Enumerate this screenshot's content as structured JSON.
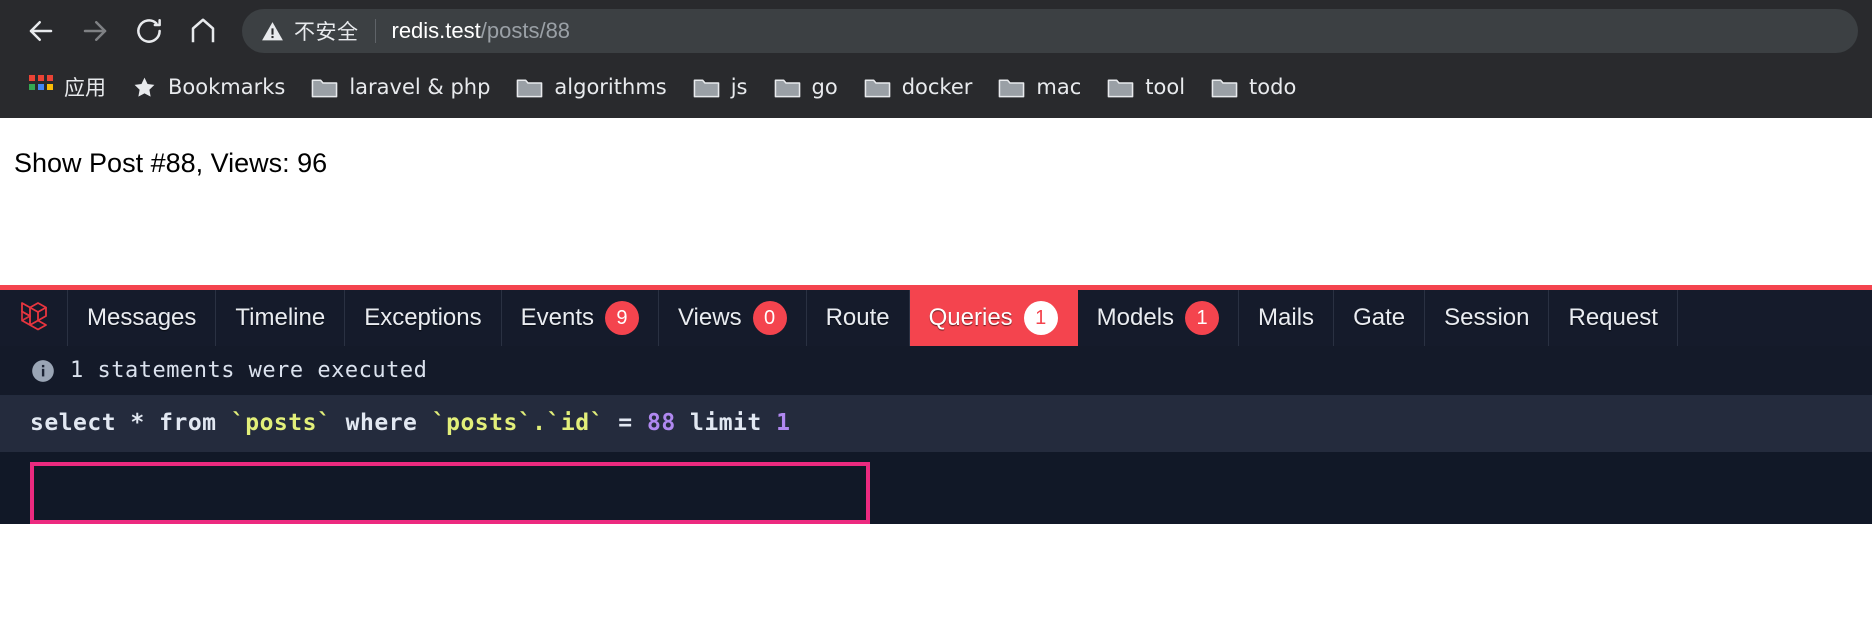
{
  "browser": {
    "nav": [
      {
        "name": "back-button",
        "icon": "arrow-left-icon",
        "enabled": true
      },
      {
        "name": "forward-button",
        "icon": "arrow-right-icon",
        "enabled": false
      },
      {
        "name": "reload-button",
        "icon": "reload-icon",
        "enabled": true
      },
      {
        "name": "home-button",
        "icon": "home-icon",
        "enabled": true
      }
    ],
    "omnibox": {
      "security_icon": "warning-triangle-icon",
      "security_label": "不安全",
      "url_host": "redis.test",
      "url_path": "/posts/88",
      "full_url": "redis.test/posts/88"
    },
    "bookmarks": [
      {
        "label": "应用",
        "icon": "apps-grid-icon"
      },
      {
        "label": "Bookmarks",
        "icon": "star-icon"
      },
      {
        "label": "laravel & php",
        "icon": "folder-icon"
      },
      {
        "label": "algorithms",
        "icon": "folder-icon"
      },
      {
        "label": "js",
        "icon": "folder-icon"
      },
      {
        "label": "go",
        "icon": "folder-icon"
      },
      {
        "label": "docker",
        "icon": "folder-icon"
      },
      {
        "label": "mac",
        "icon": "folder-icon"
      },
      {
        "label": "tool",
        "icon": "folder-icon"
      },
      {
        "label": "todo",
        "icon": "folder-icon"
      }
    ]
  },
  "page": {
    "body_text": "Show Post #88, Views: 96"
  },
  "debugbar": {
    "logo": "laravel-logo-icon",
    "accent_color": "#f4444e",
    "tabs": [
      {
        "label": "Messages",
        "badge": null,
        "active": false
      },
      {
        "label": "Timeline",
        "badge": null,
        "active": false
      },
      {
        "label": "Exceptions",
        "badge": null,
        "active": false
      },
      {
        "label": "Events",
        "badge": "9",
        "active": false
      },
      {
        "label": "Views",
        "badge": "0",
        "active": false
      },
      {
        "label": "Route",
        "badge": null,
        "active": false
      },
      {
        "label": "Queries",
        "badge": "1",
        "active": true
      },
      {
        "label": "Models",
        "badge": "1",
        "active": false
      },
      {
        "label": "Mails",
        "badge": null,
        "active": false
      },
      {
        "label": "Gate",
        "badge": null,
        "active": false
      },
      {
        "label": "Session",
        "badge": null,
        "active": false
      },
      {
        "label": "Request",
        "badge": null,
        "active": false
      }
    ],
    "status": {
      "icon": "info-circle-icon",
      "text": "1 statements were executed"
    },
    "query": {
      "segments": [
        {
          "text": "select * from ",
          "type": "plain"
        },
        {
          "text": "`posts`",
          "type": "table"
        },
        {
          "text": " where ",
          "type": "plain"
        },
        {
          "text": "`posts`.`id`",
          "type": "table"
        },
        {
          "text": " = ",
          "type": "plain"
        },
        {
          "text": "88",
          "type": "number"
        },
        {
          "text": " limit ",
          "type": "plain"
        },
        {
          "text": "1",
          "type": "number"
        }
      ],
      "full_text": "select * from `posts` where `posts`.`id` = 88 limit 1",
      "selection_highlight_color": "#ec2a7f"
    }
  }
}
